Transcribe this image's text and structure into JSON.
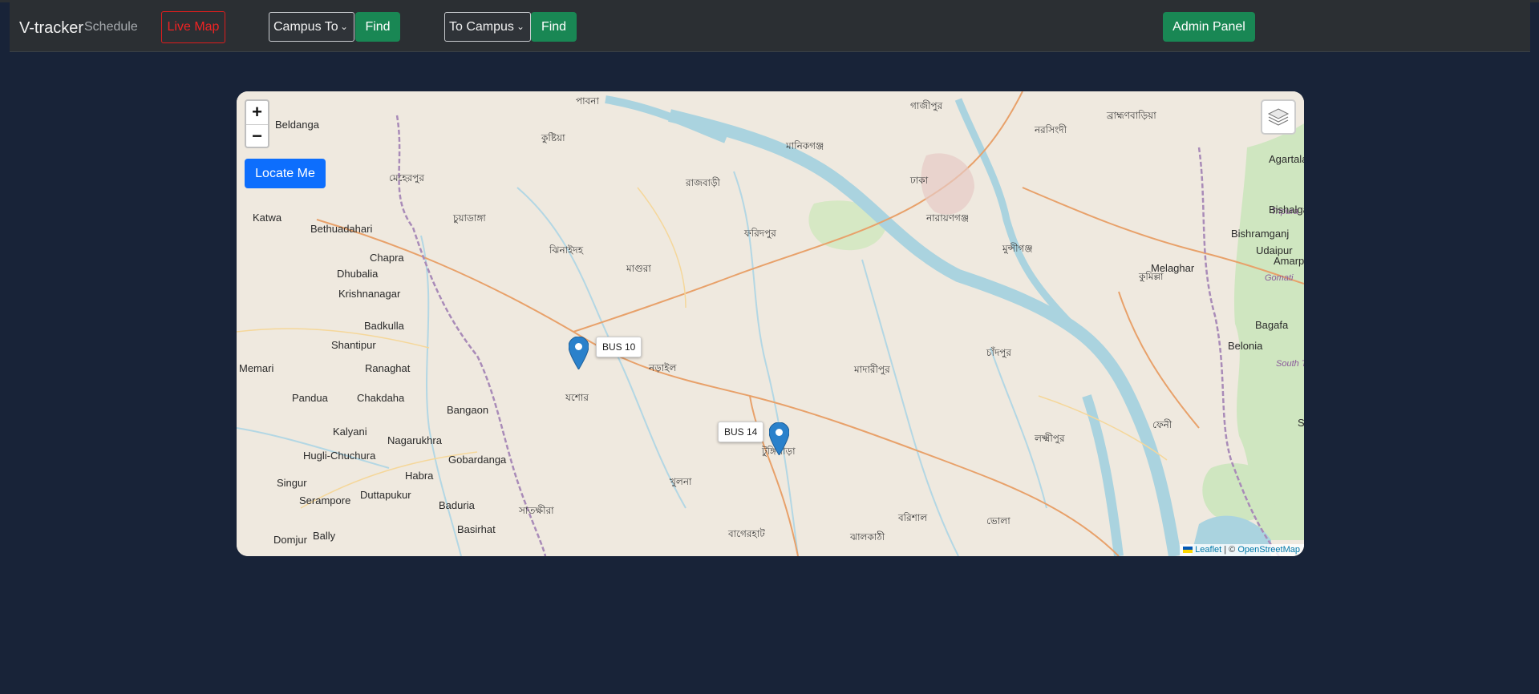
{
  "app": {
    "brand": "V-tracker"
  },
  "nav": {
    "schedule": "Schedule",
    "live_map": "Live Map"
  },
  "filters": {
    "campus_to": "Campus To",
    "find_1": "Find",
    "to_campus": "To Campus",
    "find_2": "Find"
  },
  "admin": {
    "label": "Admin Panel"
  },
  "map": {
    "zoom_in": "+",
    "zoom_out": "−",
    "locate": "Locate Me",
    "buses": [
      {
        "label": "BUS 10"
      },
      {
        "label": "BUS 14"
      }
    ],
    "attribution": {
      "leaflet": "Leaflet",
      "sep": " | © ",
      "osm": "OpenStreetMap"
    },
    "place_labels": [
      "Beldanga",
      "Katwa",
      "Bethuadahari",
      "Chapra",
      "Dhubalia",
      "Krishnanagar",
      "Badkulla",
      "Shantipur",
      "Ranaghat",
      "Memari",
      "Pandua",
      "Chakdaha",
      "Bangaon",
      "Kalyani",
      "Hugli-Chuchura",
      "Nagarukhra",
      "Gobardanga",
      "Habra",
      "Singur",
      "Duttapukur",
      "Serampore",
      "Baduria",
      "Basirhat",
      "Domjur",
      "Bally",
      "Agartala",
      "Tripura",
      "Bishalgarh",
      "Bishramganj",
      "Udaipur",
      "Melaghar",
      "Amarpur",
      "Gomati",
      "Bagafa",
      "Belonia",
      "South Tripura",
      "Sa"
    ],
    "bangla_labels": [
      "যশোর",
      "খুলনা",
      "বাগেরহাট",
      "বরিশাল",
      "ঢাকা",
      "চাঁদপুর",
      "কুমিল্লা",
      "ফরিদপুর",
      "মাদারীপুর",
      "ঝিনাইদহ",
      "কুষ্টিয়া",
      "রাজবাড়ী",
      "মাগুরা",
      "নড়াইল",
      "মুন্সীগঞ্জ",
      "নারায়ণগঞ্জ",
      "লক্ষ্মীপুর",
      "ফেনী",
      "টুঙ্গিপাড়া",
      "সাতক্ষীরা",
      "ঝালকাঠী",
      "ভোলা",
      "নরসিংদী",
      "গাজীপুর",
      "মানিকগঞ্জ",
      "মেহেরপুর",
      "চুয়াডাঙ্গা",
      "পাবনা",
      "ব্রাহ্মণবাড়িয়া"
    ]
  },
  "colors": {
    "background": "#182338",
    "navbar": "#2b2f33",
    "live_map_red": "#f02323",
    "green": "#198754",
    "locate_blue": "#0d6efd",
    "marker_blue": "#2a81cb"
  }
}
